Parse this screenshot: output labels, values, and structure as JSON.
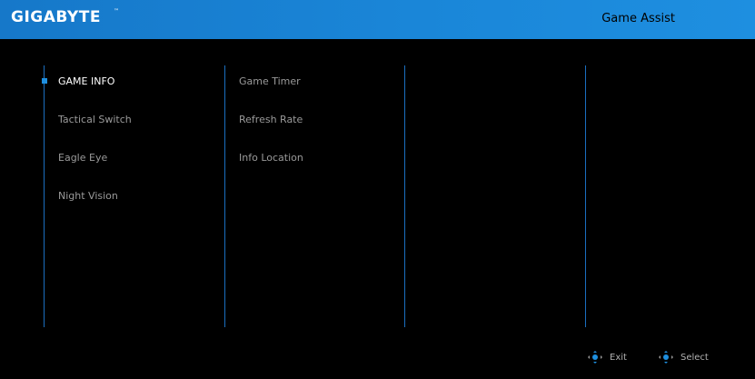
{
  "header": {
    "brand": "GIGABYTE",
    "brand_tm": "™",
    "title": "Game Assist"
  },
  "menu": {
    "primary": [
      {
        "label": "GAME INFO",
        "active": true
      },
      {
        "label": "Tactical Switch",
        "active": false
      },
      {
        "label": "Eagle Eye",
        "active": false
      },
      {
        "label": "Night Vision",
        "active": false
      }
    ],
    "secondary": [
      {
        "label": "Game Timer"
      },
      {
        "label": "Refresh Rate"
      },
      {
        "label": "Info Location"
      }
    ]
  },
  "footer": {
    "exit_label": "Exit",
    "select_label": "Select"
  },
  "colors": {
    "header_blue": "#1a86d8",
    "separator_blue": "#1b6fc0",
    "active_bullet": "#1e8fe0"
  },
  "icons": {
    "joystick": "joystick-icon",
    "bullet": "active-bullet-icon"
  }
}
